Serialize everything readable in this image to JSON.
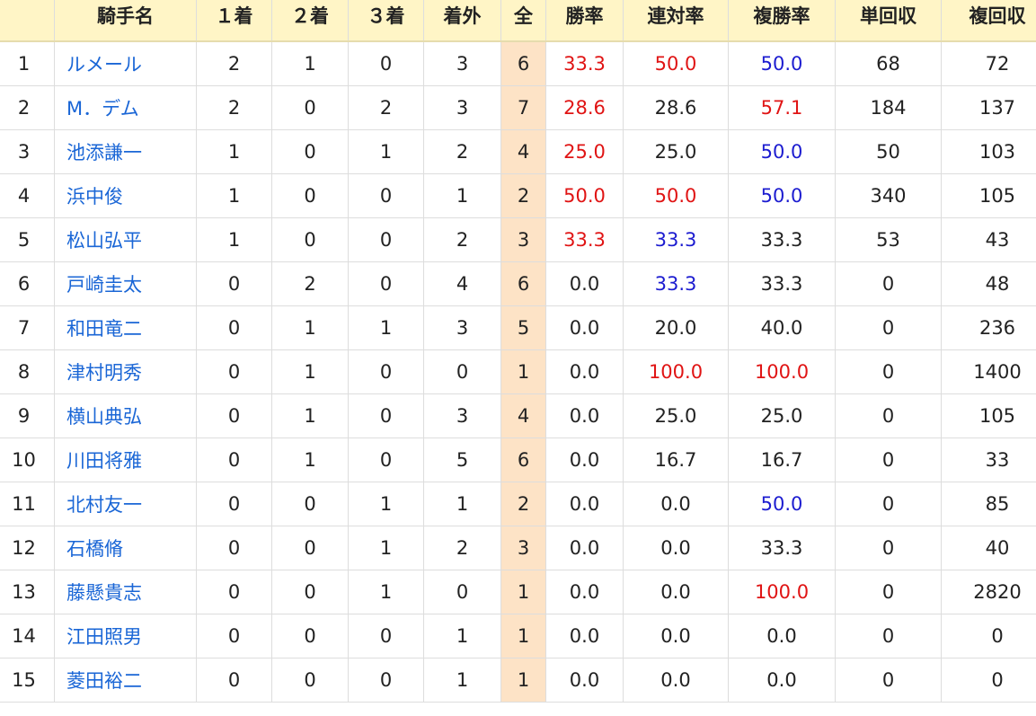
{
  "table": {
    "headers": {
      "rank": "",
      "name": "騎手名",
      "first": "１着",
      "second": "２着",
      "third": "３着",
      "out": "着外",
      "total": "全",
      "win_rate": "勝率",
      "quinella_rate": "連対率",
      "place_rate": "複勝率",
      "win_return": "単回収",
      "place_return": "複回収"
    },
    "rows": [
      {
        "rank": "1",
        "name": "ルメール",
        "first": "2",
        "second": "1",
        "third": "0",
        "out": "3",
        "total": "6",
        "win_rate": "33.3",
        "quinella_rate": "50.0",
        "place_rate": "50.0",
        "win_return": "68",
        "place_return": "72",
        "win_rate_color": "red",
        "quinella_rate_color": "red",
        "place_rate_color": "blue"
      },
      {
        "rank": "2",
        "name": "M．デム",
        "first": "2",
        "second": "0",
        "third": "2",
        "out": "3",
        "total": "7",
        "win_rate": "28.6",
        "quinella_rate": "28.6",
        "place_rate": "57.1",
        "win_return": "184",
        "place_return": "137",
        "win_rate_color": "red",
        "quinella_rate_color": "black",
        "place_rate_color": "red"
      },
      {
        "rank": "3",
        "name": "池添謙一",
        "first": "1",
        "second": "0",
        "third": "1",
        "out": "2",
        "total": "4",
        "win_rate": "25.0",
        "quinella_rate": "25.0",
        "place_rate": "50.0",
        "win_return": "50",
        "place_return": "103",
        "win_rate_color": "red",
        "quinella_rate_color": "black",
        "place_rate_color": "blue"
      },
      {
        "rank": "4",
        "name": "浜中俊",
        "first": "1",
        "second": "0",
        "third": "0",
        "out": "1",
        "total": "2",
        "win_rate": "50.0",
        "quinella_rate": "50.0",
        "place_rate": "50.0",
        "win_return": "340",
        "place_return": "105",
        "win_rate_color": "red",
        "quinella_rate_color": "red",
        "place_rate_color": "blue"
      },
      {
        "rank": "5",
        "name": "松山弘平",
        "first": "1",
        "second": "0",
        "third": "0",
        "out": "2",
        "total": "3",
        "win_rate": "33.3",
        "quinella_rate": "33.3",
        "place_rate": "33.3",
        "win_return": "53",
        "place_return": "43",
        "win_rate_color": "red",
        "quinella_rate_color": "blue",
        "place_rate_color": "black"
      },
      {
        "rank": "6",
        "name": "戸崎圭太",
        "first": "0",
        "second": "2",
        "third": "0",
        "out": "4",
        "total": "6",
        "win_rate": "0.0",
        "quinella_rate": "33.3",
        "place_rate": "33.3",
        "win_return": "0",
        "place_return": "48",
        "win_rate_color": "black",
        "quinella_rate_color": "blue",
        "place_rate_color": "black"
      },
      {
        "rank": "7",
        "name": "和田竜二",
        "first": "0",
        "second": "1",
        "third": "1",
        "out": "3",
        "total": "5",
        "win_rate": "0.0",
        "quinella_rate": "20.0",
        "place_rate": "40.0",
        "win_return": "0",
        "place_return": "236",
        "win_rate_color": "black",
        "quinella_rate_color": "black",
        "place_rate_color": "black"
      },
      {
        "rank": "8",
        "name": "津村明秀",
        "first": "0",
        "second": "1",
        "third": "0",
        "out": "0",
        "total": "1",
        "win_rate": "0.0",
        "quinella_rate": "100.0",
        "place_rate": "100.0",
        "win_return": "0",
        "place_return": "1400",
        "win_rate_color": "black",
        "quinella_rate_color": "red",
        "place_rate_color": "red"
      },
      {
        "rank": "9",
        "name": "横山典弘",
        "first": "0",
        "second": "1",
        "third": "0",
        "out": "3",
        "total": "4",
        "win_rate": "0.0",
        "quinella_rate": "25.0",
        "place_rate": "25.0",
        "win_return": "0",
        "place_return": "105",
        "win_rate_color": "black",
        "quinella_rate_color": "black",
        "place_rate_color": "black"
      },
      {
        "rank": "10",
        "name": "川田将雅",
        "first": "0",
        "second": "1",
        "third": "0",
        "out": "5",
        "total": "6",
        "win_rate": "0.0",
        "quinella_rate": "16.7",
        "place_rate": "16.7",
        "win_return": "0",
        "place_return": "33",
        "win_rate_color": "black",
        "quinella_rate_color": "black",
        "place_rate_color": "black"
      },
      {
        "rank": "11",
        "name": "北村友一",
        "first": "0",
        "second": "0",
        "third": "1",
        "out": "1",
        "total": "2",
        "win_rate": "0.0",
        "quinella_rate": "0.0",
        "place_rate": "50.0",
        "win_return": "0",
        "place_return": "85",
        "win_rate_color": "black",
        "quinella_rate_color": "black",
        "place_rate_color": "blue"
      },
      {
        "rank": "12",
        "name": "石橋脩",
        "first": "0",
        "second": "0",
        "third": "1",
        "out": "2",
        "total": "3",
        "win_rate": "0.0",
        "quinella_rate": "0.0",
        "place_rate": "33.3",
        "win_return": "0",
        "place_return": "40",
        "win_rate_color": "black",
        "quinella_rate_color": "black",
        "place_rate_color": "black"
      },
      {
        "rank": "13",
        "name": "藤懸貴志",
        "first": "0",
        "second": "0",
        "third": "1",
        "out": "0",
        "total": "1",
        "win_rate": "0.0",
        "quinella_rate": "0.0",
        "place_rate": "100.0",
        "win_return": "0",
        "place_return": "2820",
        "win_rate_color": "black",
        "quinella_rate_color": "black",
        "place_rate_color": "red"
      },
      {
        "rank": "14",
        "name": "江田照男",
        "first": "0",
        "second": "0",
        "third": "0",
        "out": "1",
        "total": "1",
        "win_rate": "0.0",
        "quinella_rate": "0.0",
        "place_rate": "0.0",
        "win_return": "0",
        "place_return": "0",
        "win_rate_color": "black",
        "quinella_rate_color": "black",
        "place_rate_color": "black"
      },
      {
        "rank": "15",
        "name": "菱田裕二",
        "first": "0",
        "second": "0",
        "third": "0",
        "out": "1",
        "total": "1",
        "win_rate": "0.0",
        "quinella_rate": "0.0",
        "place_rate": "0.0",
        "win_return": "0",
        "place_return": "0",
        "win_rate_color": "black",
        "quinella_rate_color": "black",
        "place_rate_color": "black"
      }
    ]
  },
  "colors": {
    "header_bg": "#fff5c6",
    "total_col_bg": "#fde3c6",
    "link": "#1a66d6",
    "red": "#e01414",
    "blue": "#1c1cd0",
    "border": "#dddddd"
  }
}
